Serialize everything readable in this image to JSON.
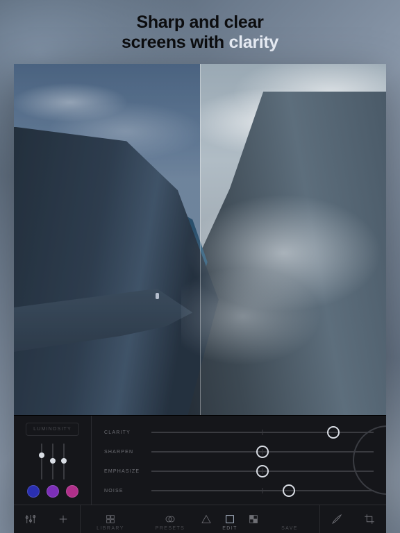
{
  "headline": {
    "line1": "Sharp and clear",
    "line2_pre": "screens with ",
    "line2_highlight": "clarity"
  },
  "leftPanel": {
    "mode_label": "LUMINOSITY",
    "miniSliders": [
      {
        "pos": 0.6
      },
      {
        "pos": 0.45
      },
      {
        "pos": 0.45
      }
    ],
    "colorDots": [
      "#2a2fb0",
      "#7c2fb8",
      "#b02f8a"
    ]
  },
  "sliders": [
    {
      "label": "CLARITY",
      "value": 0.82
    },
    {
      "label": "SHARPEN",
      "value": 0.5
    },
    {
      "label": "EMPHASIZE",
      "value": 0.5
    },
    {
      "label": "NOISE",
      "value": 0.62
    }
  ],
  "toolbar": {
    "sections": [
      {
        "id": "library",
        "label": "LIBRARY"
      },
      {
        "id": "presets",
        "label": "PRESETS"
      },
      {
        "id": "edit",
        "label": "EDIT"
      },
      {
        "id": "save",
        "label": "SAVE"
      }
    ]
  }
}
